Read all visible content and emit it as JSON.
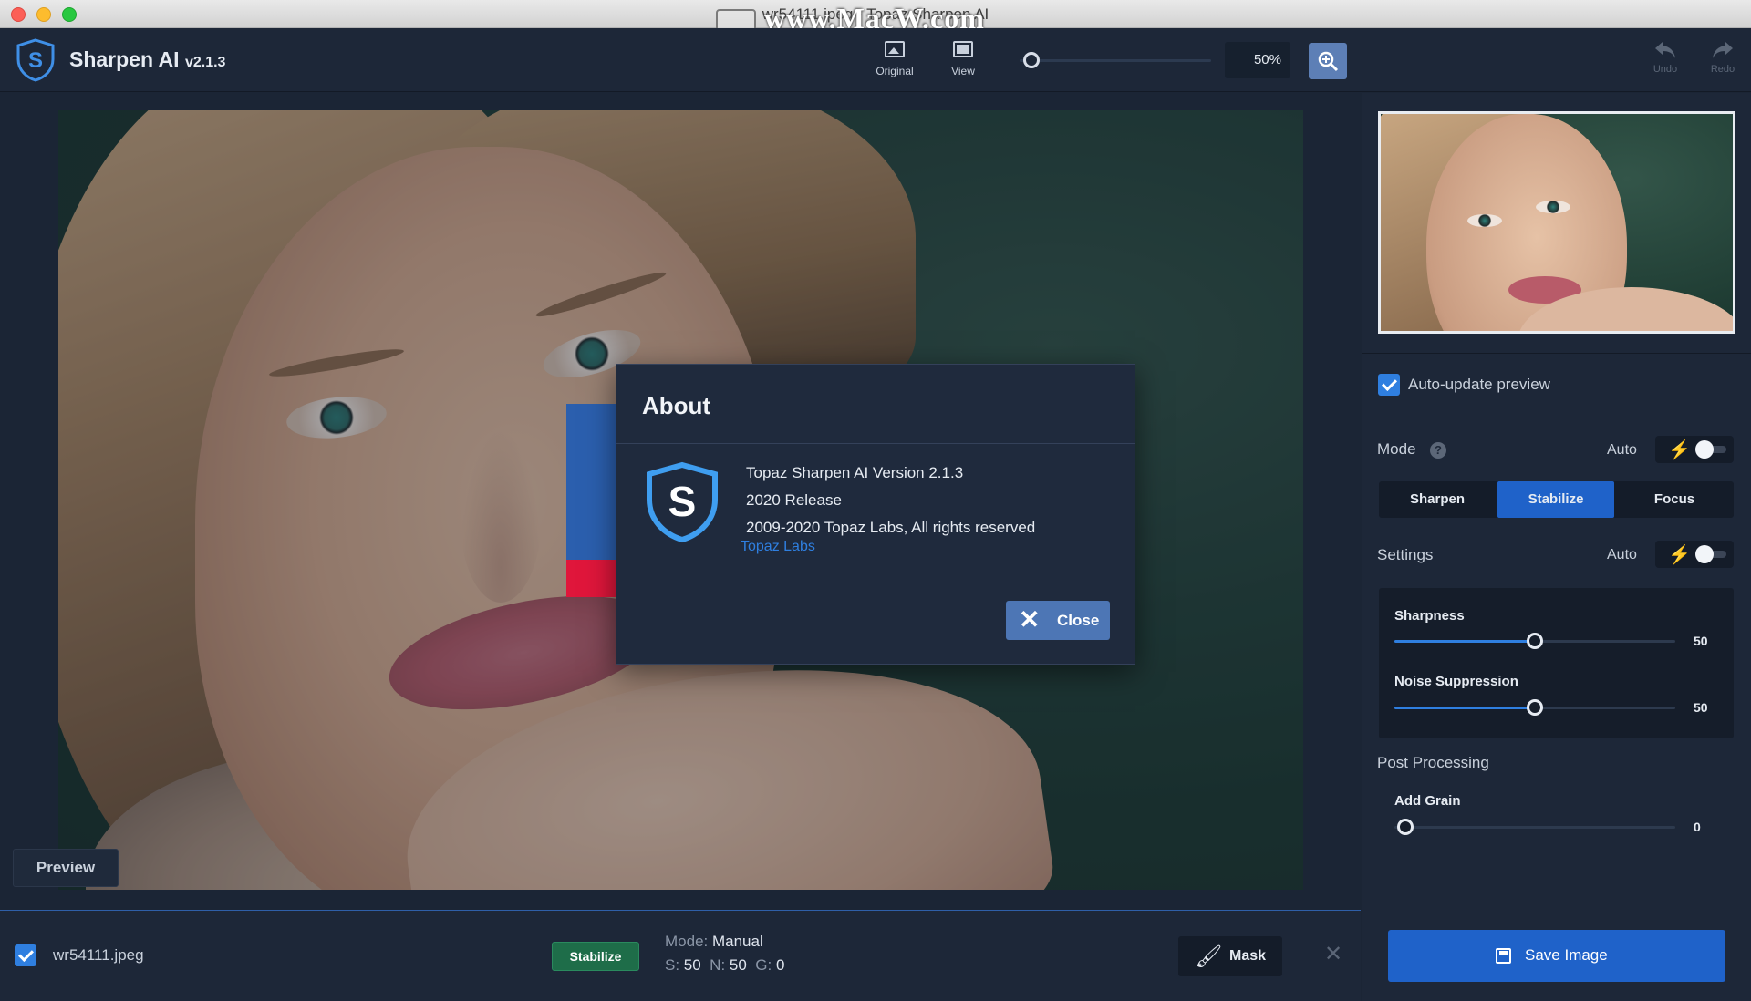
{
  "window": {
    "title": "wr54111.jpeg - Topaz Sharpen AI",
    "watermark": "www.MacW.com"
  },
  "toolbar": {
    "app_name": "Sharpen AI",
    "app_version": "v2.1.3",
    "original_label": "Original",
    "view_label": "View",
    "zoom_value": "50%",
    "undo_label": "Undo",
    "redo_label": "Redo"
  },
  "canvas": {
    "preview_label": "Preview"
  },
  "about_dialog": {
    "title": "About",
    "lines": [
      "Topaz Sharpen AI Version 2.1.3",
      "2020 Release",
      "2009-2020 Topaz Labs, All rights reserved"
    ],
    "link": "Topaz Labs",
    "close_label": "Close"
  },
  "panel": {
    "auto_update_label": "Auto-update preview",
    "auto_update_checked": true,
    "mode_label": "Mode",
    "mode_auto_label": "Auto",
    "mode_options": [
      "Sharpen",
      "Stabilize",
      "Focus"
    ],
    "mode_selected": "Stabilize",
    "settings_label": "Settings",
    "settings_auto_label": "Auto",
    "sharpness_label": "Sharpness",
    "sharpness_value": "50",
    "sharpness_fraction": 0.5,
    "noise_label": "Noise Suppression",
    "noise_value": "50",
    "noise_fraction": 0.5,
    "post_processing_label": "Post Processing",
    "grain_label": "Add Grain",
    "grain_value": "0",
    "grain_fraction": 0.0,
    "save_label": "Save Image"
  },
  "filebar": {
    "file_name": "wr54111.jpeg",
    "mode_badge": "Stabilize",
    "mode_key": "Mode:",
    "mode_value": "Manual",
    "s_key": "S:",
    "s_value": "50",
    "n_key": "N:",
    "n_value": "50",
    "g_key": "G:",
    "g_value": "0",
    "mask_label": "Mask"
  },
  "colors": {
    "accent": "#1f62c9",
    "stabilize_badge": "#1e6d49",
    "link": "#2f7fe0"
  }
}
